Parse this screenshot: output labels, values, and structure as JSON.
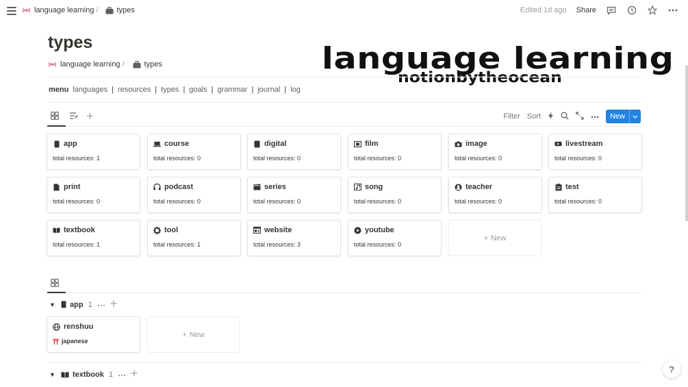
{
  "topbar": {
    "crumbs": [
      {
        "label": "language learning",
        "icon": "ribbon-icon"
      },
      {
        "label": "types",
        "icon": "briefcase-icon"
      }
    ],
    "separator": "/",
    "edited": "Edited 1d ago",
    "share": "Share"
  },
  "page": {
    "title": "types",
    "subcrumbs": [
      {
        "label": "language learning",
        "icon": "ribbon-icon"
      },
      {
        "label": "types",
        "icon": "briefcase-icon"
      }
    ],
    "separator": "/",
    "banner": {
      "line1": "language learning",
      "line2": "notionbytheocean"
    },
    "nav": {
      "menu_label": "menu",
      "links": [
        "languages",
        "resources",
        "types",
        "goals",
        "grammar",
        "journal",
        "log"
      ],
      "pipe": "|"
    }
  },
  "toolbar": {
    "filter": "Filter",
    "sort": "Sort",
    "new": "New"
  },
  "gallery": {
    "prop_label": "total resources:",
    "cards": [
      {
        "name": "app",
        "icon": "phone-icon",
        "count": "1"
      },
      {
        "name": "course",
        "icon": "laptop-icon",
        "count": "0"
      },
      {
        "name": "digital",
        "icon": "tablet-icon",
        "count": "0"
      },
      {
        "name": "film",
        "icon": "film-icon",
        "count": "0"
      },
      {
        "name": "image",
        "icon": "camera-icon",
        "count": "0"
      },
      {
        "name": "livestream",
        "icon": "tv-icon",
        "count": "0"
      },
      {
        "name": "print",
        "icon": "document-icon",
        "count": "0"
      },
      {
        "name": "podcast",
        "icon": "headphones-icon",
        "count": "0"
      },
      {
        "name": "series",
        "icon": "clapper-icon",
        "count": "0"
      },
      {
        "name": "song",
        "icon": "music-icon",
        "count": "0"
      },
      {
        "name": "teacher",
        "icon": "person-icon",
        "count": "0"
      },
      {
        "name": "test",
        "icon": "clipboard-icon",
        "count": "0"
      },
      {
        "name": "textbook",
        "icon": "book-icon",
        "count": "1"
      },
      {
        "name": "tool",
        "icon": "gear-icon",
        "count": "1"
      },
      {
        "name": "website",
        "icon": "browser-icon",
        "count": "3"
      },
      {
        "name": "youtube",
        "icon": "play-icon",
        "count": "0"
      }
    ],
    "new_label": "New"
  },
  "board": {
    "groups": [
      {
        "name": "app",
        "icon": "phone-icon",
        "count": "1"
      },
      {
        "name": "textbook",
        "icon": "book-icon",
        "count": "1"
      }
    ],
    "card": {
      "name": "renshuu",
      "icon": "globe-icon",
      "tag": "japanese",
      "tag_icon": "torii-icon"
    },
    "new_label": "New"
  },
  "help": "?"
}
